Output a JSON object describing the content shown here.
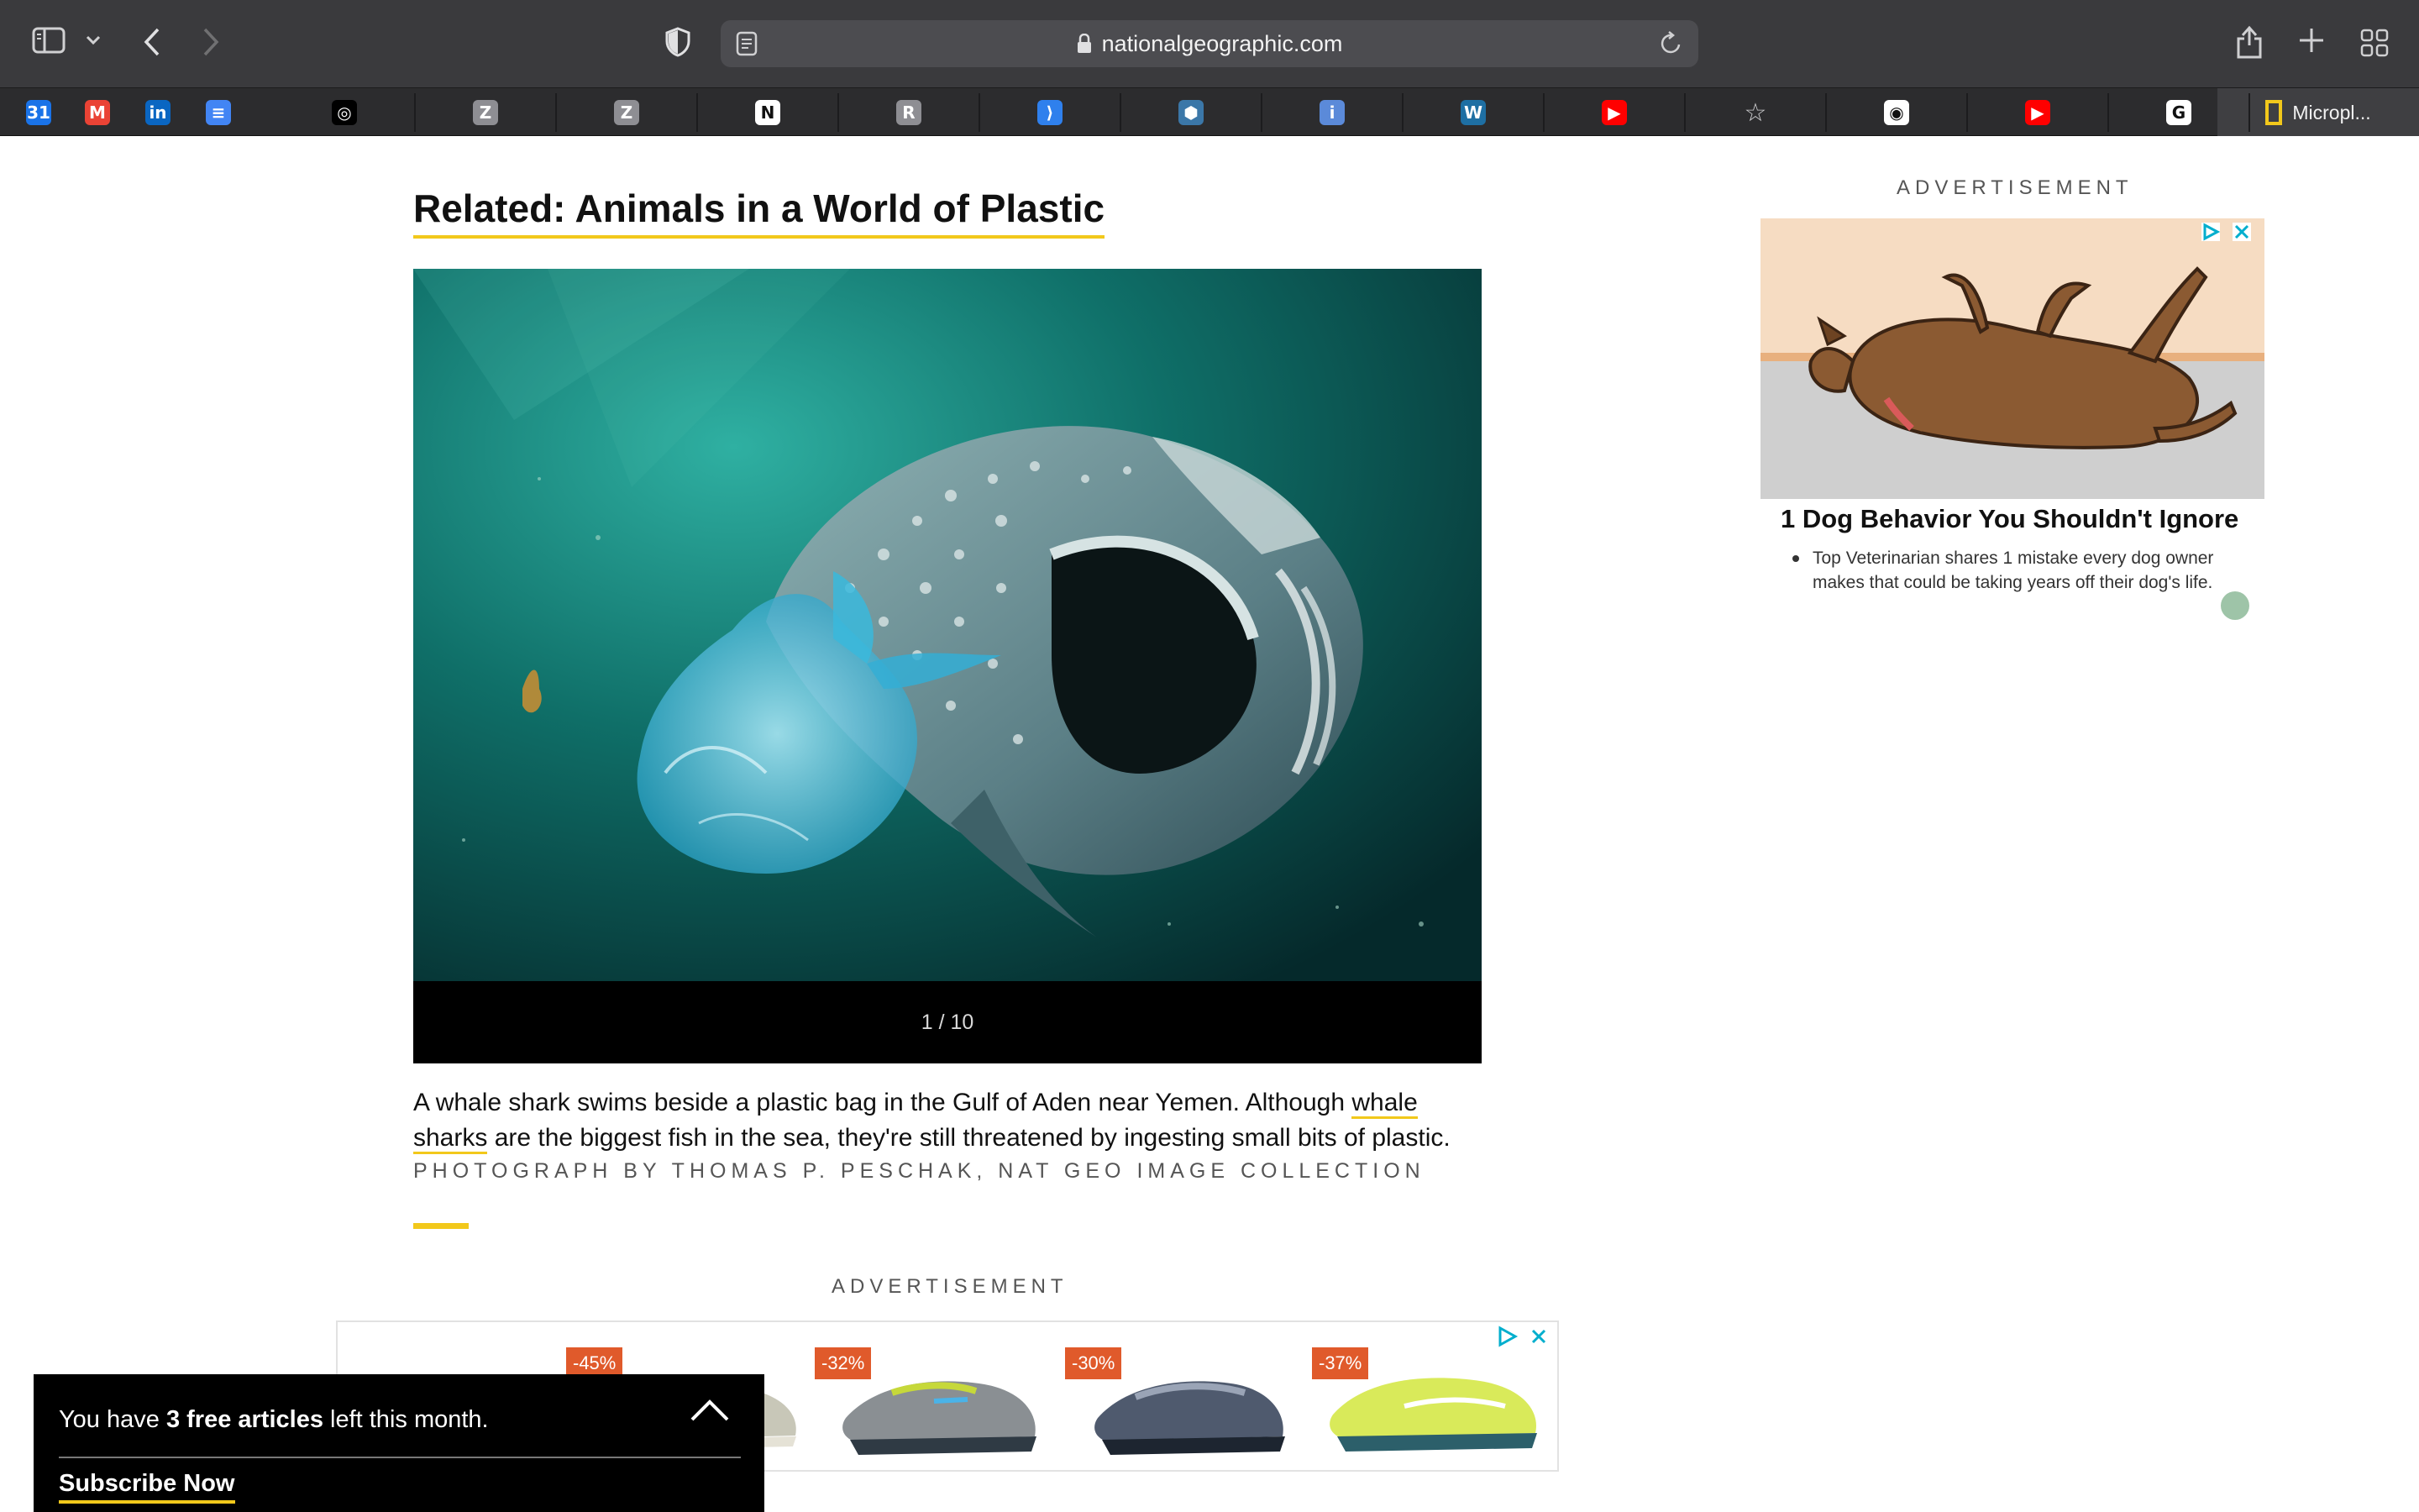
{
  "browser": {
    "url": "nationalgeographic.com",
    "favorites": [
      {
        "name": "google-calendar",
        "glyph": "31",
        "color": "#1a73e8"
      },
      {
        "name": "gmail",
        "glyph": "M",
        "color": "#ea4335"
      },
      {
        "name": "linkedin",
        "glyph": "in",
        "color": "#0a66c2"
      },
      {
        "name": "google-docs",
        "glyph": "≡",
        "color": "#4285f4"
      },
      {
        "name": "tab-icon",
        "glyph": "◎",
        "color": "#000"
      },
      {
        "name": "tab-z-1",
        "glyph": "Z",
        "color": "#8e8e93"
      },
      {
        "name": "tab-z-2",
        "glyph": "Z",
        "color": "#8e8e93"
      },
      {
        "name": "notion",
        "glyph": "N",
        "color": "#fff"
      },
      {
        "name": "tab-r",
        "glyph": "R",
        "color": "#8e8e93"
      },
      {
        "name": "vscode",
        "glyph": "⟩",
        "color": "#2f80ed"
      },
      {
        "name": "python",
        "glyph": "⬢",
        "color": "#3b77a8"
      },
      {
        "name": "info-site",
        "glyph": "i",
        "color": "#5b8ad9"
      },
      {
        "name": "wordpress",
        "glyph": "W",
        "color": "#1e6fa3"
      },
      {
        "name": "youtube-1",
        "glyph": "▶",
        "color": "#ff0000"
      },
      {
        "name": "bookmark-star",
        "glyph": "☆",
        "color": "transparent"
      },
      {
        "name": "github",
        "glyph": "◉",
        "color": "#fff"
      },
      {
        "name": "youtube-2",
        "glyph": "▶",
        "color": "#ff0000"
      },
      {
        "name": "google",
        "glyph": "G",
        "color": "#fff"
      }
    ],
    "active_tab_label": "Micropl..."
  },
  "article": {
    "related_title": "Related: Animals in a World of Plastic",
    "gallery_counter": "1 / 10",
    "caption_part1": "A whale shark swims beside a plastic bag in the Gulf of Aden near Yemen. Although ",
    "caption_link": "whale sharks",
    "caption_part2": " are the biggest fish in the sea, they're still threatened by ingesting small bits of plastic.",
    "credit": "PHOTOGRAPH BY THOMAS P. PESCHAK, NAT GEO IMAGE COLLECTION"
  },
  "ads": {
    "label": "ADVERTISEMENT",
    "side": {
      "title": "1 Dog Behavior You Shouldn't Ignore",
      "text": "Top Veterinarian shares 1 mistake every dog owner makes that could be taking years off their dog's life."
    },
    "shoes": [
      {
        "discount": "-45%"
      },
      {
        "discount": "-32%"
      },
      {
        "discount": "-30%"
      },
      {
        "discount": "-37%"
      }
    ]
  },
  "paywall": {
    "prefix": "You have ",
    "count": "3 free articles",
    "suffix": " left this month.",
    "subscribe": "Subscribe Now"
  },
  "colors": {
    "accent_yellow": "#f2c81b",
    "chrome_bg": "#3a3a3d",
    "discount_tag": "#e05a2b"
  }
}
